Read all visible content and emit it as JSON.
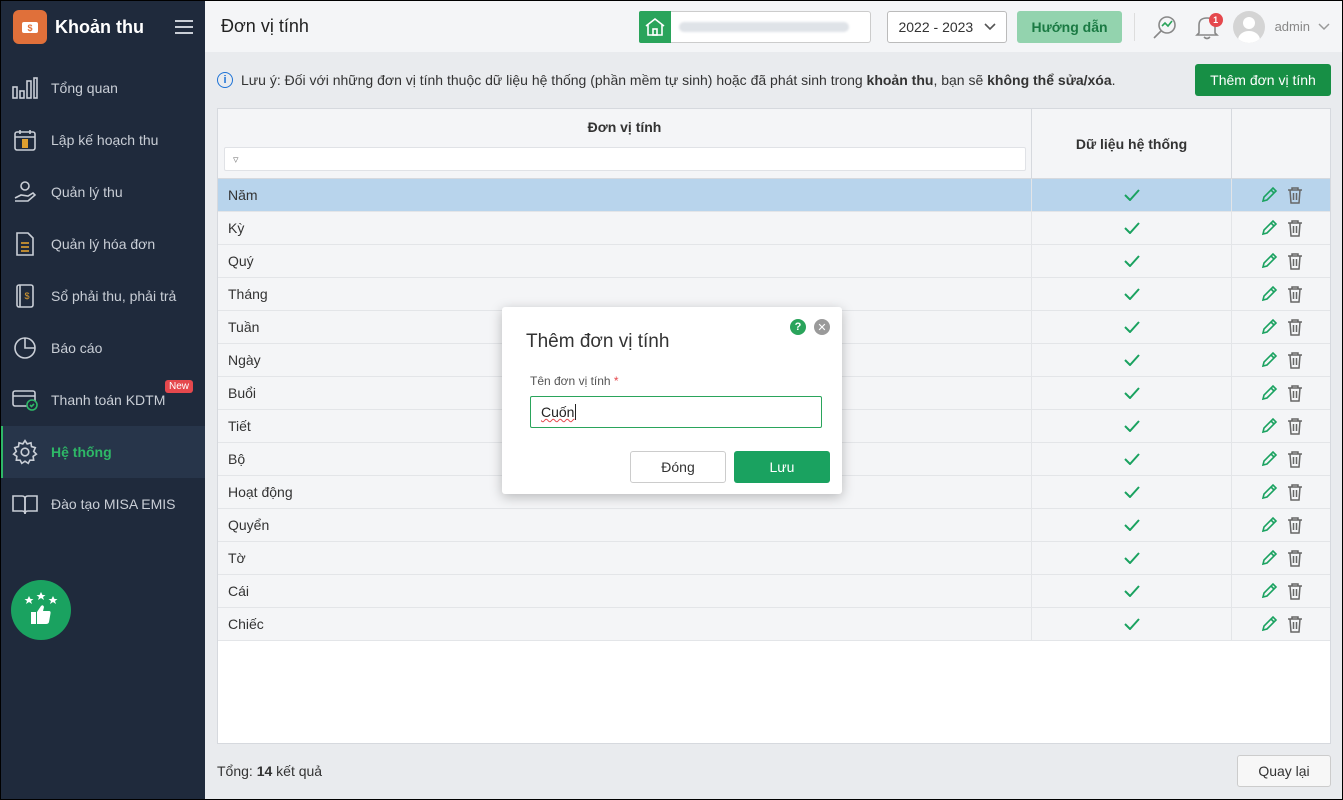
{
  "app": {
    "title": "Khoản thu"
  },
  "sidebar": {
    "items": [
      {
        "label": "Tổng quan",
        "icon": "chart-bars-icon"
      },
      {
        "label": "Lập kế hoạch thu",
        "icon": "calendar-money-icon"
      },
      {
        "label": "Quản lý thu",
        "icon": "hand-coin-icon"
      },
      {
        "label": "Quản lý hóa đơn",
        "icon": "invoice-icon"
      },
      {
        "label": "Sổ phải thu, phải trả",
        "icon": "ledger-icon"
      },
      {
        "label": "Báo cáo",
        "icon": "pie-chart-icon"
      },
      {
        "label": "Thanh toán KDTM",
        "icon": "card-payment-icon",
        "badge": "New"
      },
      {
        "label": "Hệ thống",
        "icon": "gear-icon",
        "active": true
      },
      {
        "label": "Đào tạo MISA EMIS",
        "icon": "book-icon"
      }
    ]
  },
  "header": {
    "page_title": "Đơn vị tính",
    "year": "2022 - 2023",
    "guide_label": "Hướng dẫn",
    "notification_count": "1",
    "user": "admin"
  },
  "main": {
    "notice_prefix": "Lưu ý: Đối với những đơn vị tính thuộc dữ liệu hệ thống (phần mềm tự sinh) hoặc đã phát sinh trong ",
    "notice_bold1": "khoản thu",
    "notice_mid": ", bạn sẽ ",
    "notice_bold2": "không thể sửa/xóa",
    "notice_end": ".",
    "add_button": "Thêm đơn vị tính",
    "grid": {
      "col_unit": "Đơn vị tính",
      "col_system": "Dữ liệu hệ thống",
      "filter_placeholder": "▿",
      "rows": [
        "Năm",
        "Kỳ",
        "Quý",
        "Tháng",
        "Tuần",
        "Ngày",
        "Buổi",
        "Tiết",
        "Bộ",
        "Hoạt động",
        "Quyển",
        "Tờ",
        "Cái",
        "Chiếc"
      ]
    },
    "total_label": "Tổng: ",
    "total_count": "14",
    "total_suffix": " kết quả",
    "reload_button": "Quay lại"
  },
  "modal": {
    "title": "Thêm đơn vị tính",
    "field_label": "Tên đơn vị tính",
    "required_mark": "*",
    "field_value": "Cuốn",
    "cancel_label": "Đóng",
    "save_label": "Lưu"
  },
  "colors": {
    "accent": "#1aa260",
    "sidebar_bg": "#1f2a3c",
    "selected_row": "#b8d4ec"
  }
}
